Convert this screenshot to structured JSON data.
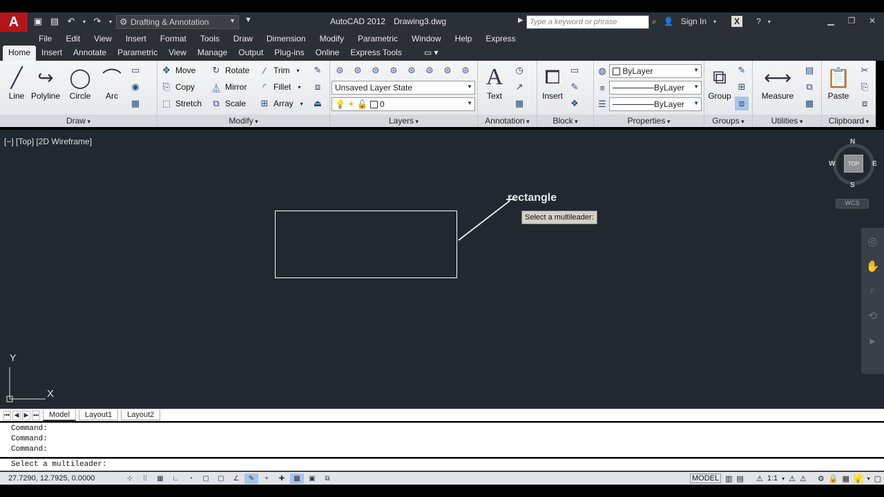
{
  "titlebar": {
    "app_icon": "A",
    "workspace": "Drafting & Annotation",
    "app_name": "AutoCAD 2012",
    "doc_name": "Drawing3.dwg",
    "search_placeholder": "Type a keyword or phrase",
    "sign_in": "Sign In"
  },
  "menubar": [
    "File",
    "Edit",
    "View",
    "Insert",
    "Format",
    "Tools",
    "Draw",
    "Dimension",
    "Modify",
    "Parametric",
    "Window",
    "Help",
    "Express"
  ],
  "ribbon_tabs": [
    "Home",
    "Insert",
    "Annotate",
    "Parametric",
    "View",
    "Manage",
    "Output",
    "Plug-ins",
    "Online",
    "Express Tools"
  ],
  "ribbon": {
    "draw": {
      "title": "Draw",
      "line": "Line",
      "polyline": "Polyline",
      "circle": "Circle",
      "arc": "Arc"
    },
    "modify": {
      "title": "Modify",
      "move": "Move",
      "rotate": "Rotate",
      "trim": "Trim",
      "copy": "Copy",
      "mirror": "Mirror",
      "fillet": "Fillet",
      "stretch": "Stretch",
      "scale": "Scale",
      "array": "Array"
    },
    "layers": {
      "title": "Layers",
      "layer_state": "Unsaved Layer State",
      "current_layer": "0"
    },
    "annotation": {
      "title": "Annotation",
      "text": "Text"
    },
    "block": {
      "title": "Block",
      "insert": "Insert"
    },
    "properties": {
      "title": "Properties",
      "color": "ByLayer",
      "linetype": "ByLayer",
      "lineweight": "ByLayer"
    },
    "groups": {
      "title": "Groups",
      "group": "Group"
    },
    "utilities": {
      "title": "Utilities",
      "measure": "Measure"
    },
    "clipboard": {
      "title": "Clipboard",
      "paste": "Paste"
    }
  },
  "canvas": {
    "viewport_label": "[−] [Top] [2D Wireframe]",
    "mtext": "rectangle",
    "tooltip": "Select a multileader:",
    "viewcube": {
      "top": "TOP",
      "n": "N",
      "s": "S",
      "e": "E",
      "w": "W"
    },
    "wcs": "WCS",
    "ucs_x": "X",
    "ucs_y": "Y"
  },
  "layout_tabs": [
    "Model",
    "Layout1",
    "Layout2"
  ],
  "command_history": [
    "Command:",
    "Command:",
    "Command:"
  ],
  "command_prompt": "Select a multileader:",
  "statusbar": {
    "coords": "27.7290, 12.7925, 0.0000",
    "model": "MODEL",
    "scale": "1:1"
  }
}
